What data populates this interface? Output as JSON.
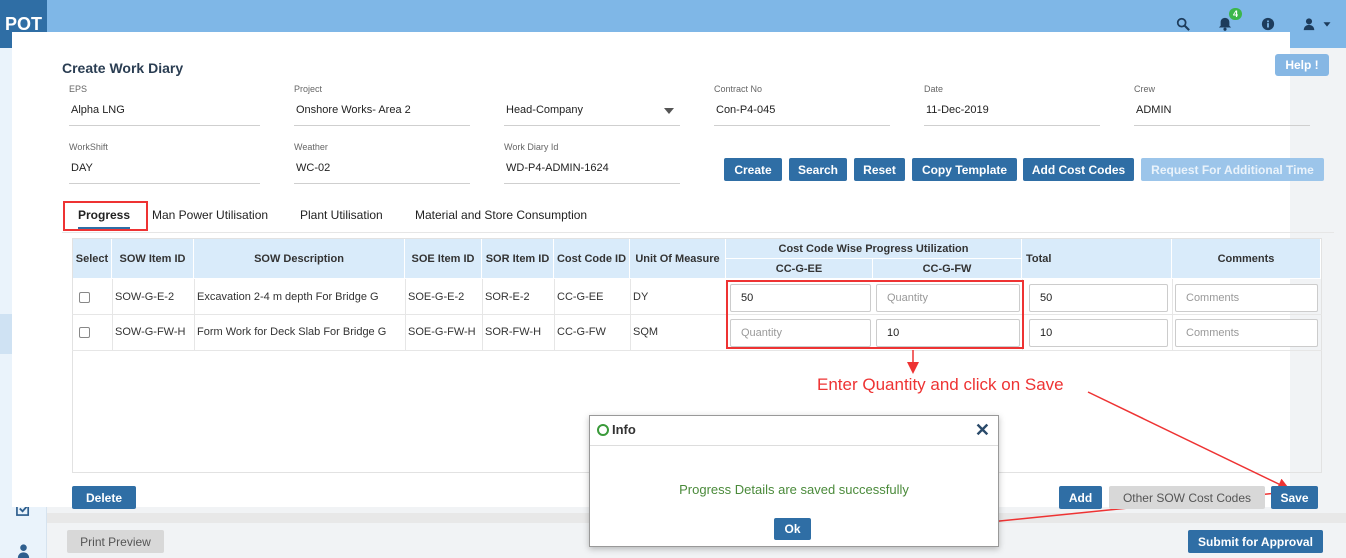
{
  "app": {
    "logo": "POT"
  },
  "topbar": {
    "notification_count": "4",
    "icons": [
      "search-icon",
      "bell-icon",
      "info-icon",
      "user-icon",
      "caret-down-icon"
    ]
  },
  "sidebar": {
    "icons": [
      "building-icon",
      "folder-icon",
      "folder-open-icon",
      "calendar-icon",
      "cart-icon",
      "users-icon",
      "database-icon",
      "piggy-bank-icon",
      "dashboard-icon",
      "list-icon",
      "checklist-icon",
      "user-icon"
    ]
  },
  "page": {
    "title": "Create Work Diary",
    "help_label": "Help !"
  },
  "form": {
    "eps": {
      "label": "EPS",
      "value": "Alpha LNG"
    },
    "project": {
      "label": "Project",
      "value": "Onshore  Works- Area 2"
    },
    "company": {
      "value": "Head-Company"
    },
    "contract": {
      "label": "Contract No",
      "value": "Con-P4-045"
    },
    "date": {
      "label": "Date",
      "value": "11-Dec-2019"
    },
    "crew": {
      "label": "Crew",
      "value": "ADMIN"
    },
    "workshift": {
      "label": "WorkShift",
      "value": "DAY"
    },
    "weather": {
      "label": "Weather",
      "value": "WC-02"
    },
    "diary_id": {
      "label": "Work Diary Id",
      "value": "WD-P4-ADMIN-1624"
    }
  },
  "actions": {
    "create": "Create",
    "search": "Search",
    "reset": "Reset",
    "copy_template": "Copy Template",
    "add_cost_codes": "Add Cost Codes",
    "request_time": "Request For Additional Time"
  },
  "tabs": [
    "Progress",
    "Man Power Utilisation",
    "Plant Utilisation",
    "Material and Store Consumption"
  ],
  "table": {
    "headers": {
      "select": "Select",
      "sow_item": "SOW Item ID",
      "sow_desc": "SOW Description",
      "soe_item": "SOE Item ID",
      "sor_item": "SOR Item ID",
      "cost_code": "Cost Code ID",
      "uom": "Unit Of Measure",
      "group": "Cost Code Wise Progress Utilization",
      "cc1": "CC-G-EE",
      "cc2": "CC-G-FW",
      "total": "Total",
      "comments": "Comments"
    },
    "rows": [
      {
        "sow_item": "SOW-G-E-2",
        "sow_desc": "Excavation 2-4 m depth For Bridge G",
        "soe_item": "SOE-G-E-2",
        "sor_item": "SOR-E-2",
        "cost_code": "CC-G-EE",
        "uom": "DY",
        "cc1": "50",
        "cc2": "Quantity",
        "total": "50",
        "comments": "Comments"
      },
      {
        "sow_item": "SOW-G-FW-H",
        "sow_desc": "Form Work for Deck Slab For Bridge G",
        "soe_item": "SOE-G-FW-H",
        "sor_item": "SOR-FW-H",
        "cost_code": "CC-G-FW",
        "uom": "SQM",
        "cc1": "Quantity",
        "cc2": "10",
        "total": "10",
        "comments": "Comments"
      }
    ]
  },
  "annotation": "Enter Quantity and click on Save",
  "footer": {
    "delete": "Delete",
    "add": "Add",
    "other_sow": "Other SOW Cost Codes",
    "save": "Save",
    "print_preview": "Print Preview",
    "submit": "Submit for Approval"
  },
  "dialog": {
    "title": "Info",
    "message": "Progress Details are saved successfully",
    "ok": "Ok"
  }
}
